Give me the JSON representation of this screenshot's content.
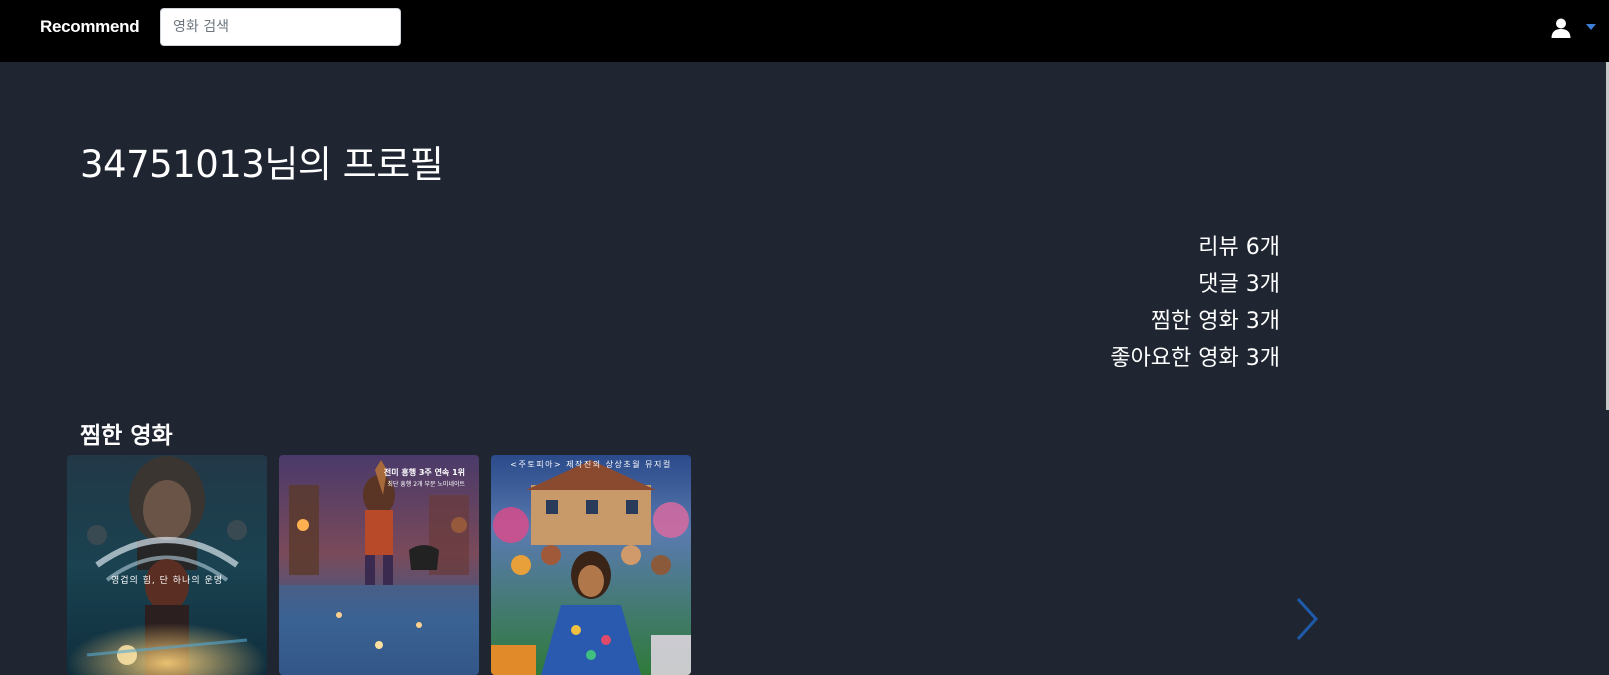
{
  "navbar": {
    "brand": "Recommend",
    "search_placeholder": "영화 검색",
    "user_icon": "user-icon",
    "caret_icon": "caret-down-icon"
  },
  "profile": {
    "title": "34751013님의 프로필",
    "stats": [
      "리뷰 6개",
      "댓글 3개",
      "찜한 영화 3개",
      "좋아요한 영화 3개"
    ]
  },
  "wishlist": {
    "title": "찜한 영화",
    "movies": [
      {
        "poster_text": "영겁의 힘, 단 하나의 운명"
      },
      {
        "poster_top_line_1": "전미 흥행 3주 연속 1위",
        "poster_top_line_2": "최단 흥행 2개 부문 노미네이트"
      },
      {
        "poster_top_line": "<주토피아> 제작진의 상상초월 뮤지컬"
      }
    ],
    "next_icon": "chevron-right-icon"
  },
  "colors": {
    "background": "#1f2531",
    "navbar": "#000000",
    "accent": "#0d6efd"
  }
}
